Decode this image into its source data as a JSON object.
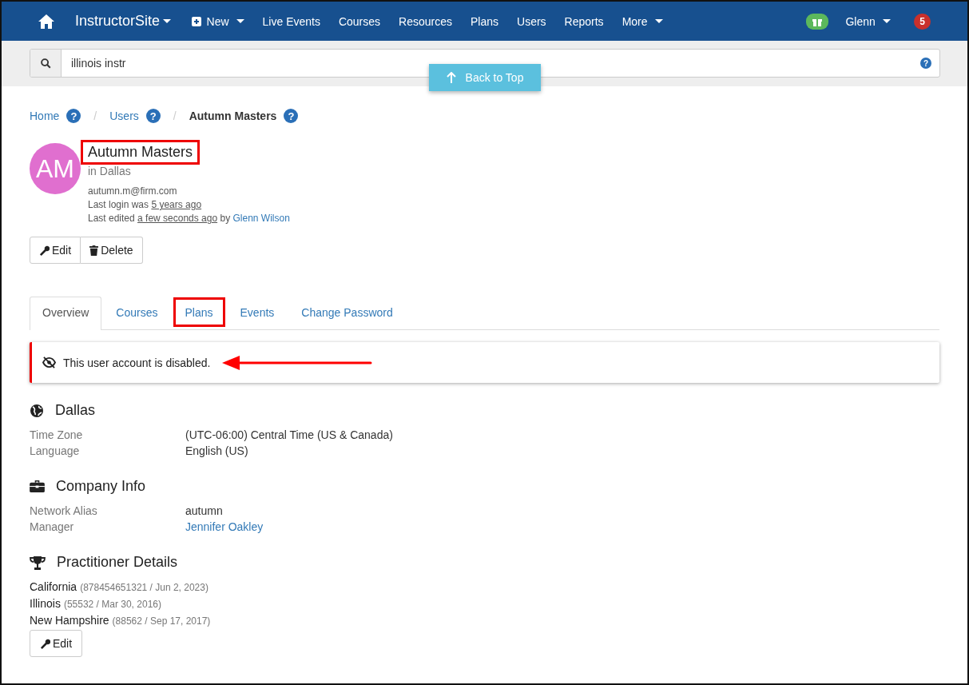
{
  "navbar": {
    "brand": "InstructorSite",
    "items": [
      {
        "label": "New",
        "kind": "new"
      },
      {
        "label": "Live Events",
        "kind": "link"
      },
      {
        "label": "Courses",
        "kind": "link"
      },
      {
        "label": "Resources",
        "kind": "link"
      },
      {
        "label": "Plans",
        "kind": "link"
      },
      {
        "label": "Users",
        "kind": "link"
      },
      {
        "label": "Reports",
        "kind": "link"
      },
      {
        "label": "More",
        "kind": "menu"
      }
    ],
    "user": "Glenn",
    "notifications": "5"
  },
  "search": {
    "value": "illinois instr",
    "help": "?"
  },
  "back_to_top": "Back to Top",
  "breadcrumb": [
    {
      "label": "Home",
      "current": false,
      "help": "?"
    },
    {
      "separator": "/",
      "label": "Users",
      "current": false,
      "help": "?"
    },
    {
      "separator": "/",
      "label": "Autumn Masters",
      "current": true,
      "help": "?"
    }
  ],
  "profile": {
    "initials": "AM",
    "name": "Autumn Masters",
    "highlighted": true,
    "location": "in Dallas",
    "email": "autumn.m@firm.com",
    "last_login": {
      "prefix": "Last login was",
      "link": "5 years ago"
    },
    "last_edited": {
      "prefix": "Last edited",
      "link": "a few seconds ago",
      "by": "by",
      "user": "Glenn Wilson"
    }
  },
  "actions": [
    {
      "label": "Edit",
      "kind": "edit"
    },
    {
      "label": "Delete",
      "kind": "delete"
    }
  ],
  "tabs": [
    {
      "label": "Overview",
      "selected": true,
      "highlighted": false
    },
    {
      "label": "Courses",
      "selected": false,
      "highlighted": false
    },
    {
      "label": "Plans",
      "selected": false,
      "highlighted": true
    },
    {
      "label": "Events",
      "selected": false,
      "highlighted": false
    },
    {
      "label": "Change Password",
      "selected": false,
      "highlighted": false
    }
  ],
  "alert": {
    "text": "This user account is disabled."
  },
  "sections": [
    {
      "title": "Dallas",
      "kind": "globe",
      "rows": [
        {
          "label": "Time Zone",
          "value": "(UTC-06:00) Central Time (US & Canada)",
          "link": false
        },
        {
          "label": "Language",
          "value": "English (US)",
          "link": false
        }
      ]
    },
    {
      "title": "Company Info",
      "kind": "briefcase",
      "rows": [
        {
          "label": "Network Alias",
          "value": "autumn",
          "link": false
        },
        {
          "label": "Manager",
          "value": "Jennifer Oakley",
          "link": true
        }
      ]
    }
  ],
  "practitioner": {
    "title": "Practitioner Details",
    "licenses": [
      {
        "state": "California",
        "detail": "(878454651321 / Jun 2, 2023)"
      },
      {
        "state": "Illinois",
        "detail": "(55532 / Mar 30, 2016)"
      },
      {
        "state": "New Hampshire",
        "detail": "(88562 / Sep 17, 2017)"
      }
    ],
    "button": "Edit"
  }
}
